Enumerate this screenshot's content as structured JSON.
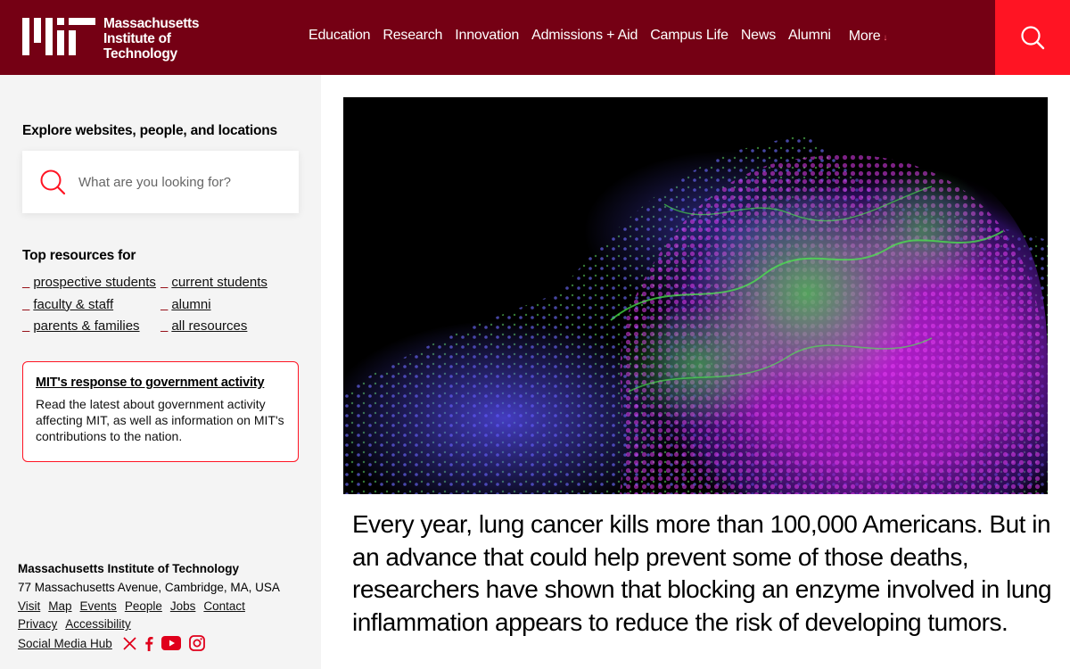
{
  "header": {
    "logo_lines": [
      "Massachusetts",
      "Institute of",
      "Technology"
    ],
    "nav": [
      "Education",
      "Research",
      "Innovation",
      "Admissions + Aid",
      "Campus Life",
      "News",
      "Alumni"
    ],
    "more_label": "More",
    "more_arrow": "↓"
  },
  "sidebar": {
    "explore_title": "Explore websites, people, and locations",
    "search_placeholder": "What are you looking for?",
    "resources_title": "Top resources for",
    "resources": [
      "prospective students",
      "current students",
      "faculty & staff",
      "alumni",
      "parents & families",
      "all resources"
    ],
    "notice": {
      "title": "MIT's response to government activity",
      "body": "Read the latest about government activity affecting MIT, as well as information on MIT's contributions to the nation."
    }
  },
  "footer": {
    "org": "Massachusetts Institute of Technology",
    "address": "77 Massachusetts Avenue, Cambridge, MA, USA",
    "links": [
      "Visit",
      "Map",
      "Events",
      "People",
      "Jobs",
      "Contact"
    ],
    "links2": [
      "Privacy",
      "Accessibility"
    ],
    "social_hub": "Social Media Hub",
    "social_icons": [
      "x-icon",
      "facebook-icon",
      "youtube-icon",
      "instagram-icon"
    ]
  },
  "main": {
    "hero_alt": "microscope-image",
    "headline": "Every year, lung cancer kills more than 100,000 Americans. But in an advance that could help prevent some of those deaths, researchers have shown that blocking an enzyme involved in lung inflammation appears to reduce the risk of developing tumors."
  },
  "colors": {
    "header_bg": "#750014",
    "accent_red": "#ff1423",
    "sidebar_bg": "#f4f4f4"
  }
}
